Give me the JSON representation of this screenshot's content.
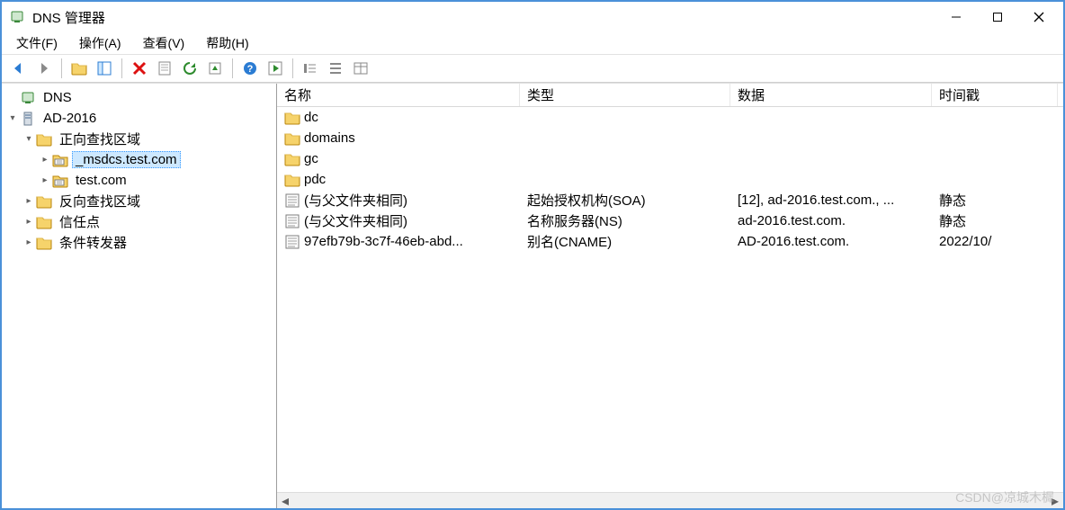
{
  "titlebar": {
    "title": "DNS 管理器"
  },
  "menubar": {
    "file": "文件(F)",
    "action": "操作(A)",
    "view": "查看(V)",
    "help": "帮助(H)"
  },
  "toolbar_icons": [
    "back",
    "forward",
    "up",
    "show-hide-tree",
    "delete",
    "properties",
    "refresh",
    "export",
    "help",
    "stop",
    "list1",
    "list2",
    "list3"
  ],
  "tree": {
    "root": {
      "label": "DNS"
    },
    "server": {
      "label": "AD-2016"
    },
    "fwd": {
      "label": "正向查找区域"
    },
    "msdcs": {
      "label": "_msdcs.test.com"
    },
    "test": {
      "label": "test.com"
    },
    "rev": {
      "label": "反向查找区域"
    },
    "trust": {
      "label": "信任点"
    },
    "cond": {
      "label": "条件转发器"
    }
  },
  "columns": {
    "name": "名称",
    "type": "类型",
    "data": "数据",
    "ts": "时间戳"
  },
  "records": [
    {
      "icon": "folder",
      "name": "dc",
      "type": "",
      "data": "",
      "ts": ""
    },
    {
      "icon": "folder",
      "name": "domains",
      "type": "",
      "data": "",
      "ts": ""
    },
    {
      "icon": "folder",
      "name": "gc",
      "type": "",
      "data": "",
      "ts": ""
    },
    {
      "icon": "folder",
      "name": "pdc",
      "type": "",
      "data": "",
      "ts": ""
    },
    {
      "icon": "record",
      "name": "(与父文件夹相同)",
      "type": "起始授权机构(SOA)",
      "data": "[12], ad-2016.test.com., ...",
      "ts": "静态"
    },
    {
      "icon": "record",
      "name": "(与父文件夹相同)",
      "type": "名称服务器(NS)",
      "data": "ad-2016.test.com.",
      "ts": "静态"
    },
    {
      "icon": "record",
      "name": "97efb79b-3c7f-46eb-abd...",
      "type": "别名(CNAME)",
      "data": "AD-2016.test.com.",
      "ts": "2022/10/"
    }
  ],
  "watermark": "CSDN@凉城木樨"
}
